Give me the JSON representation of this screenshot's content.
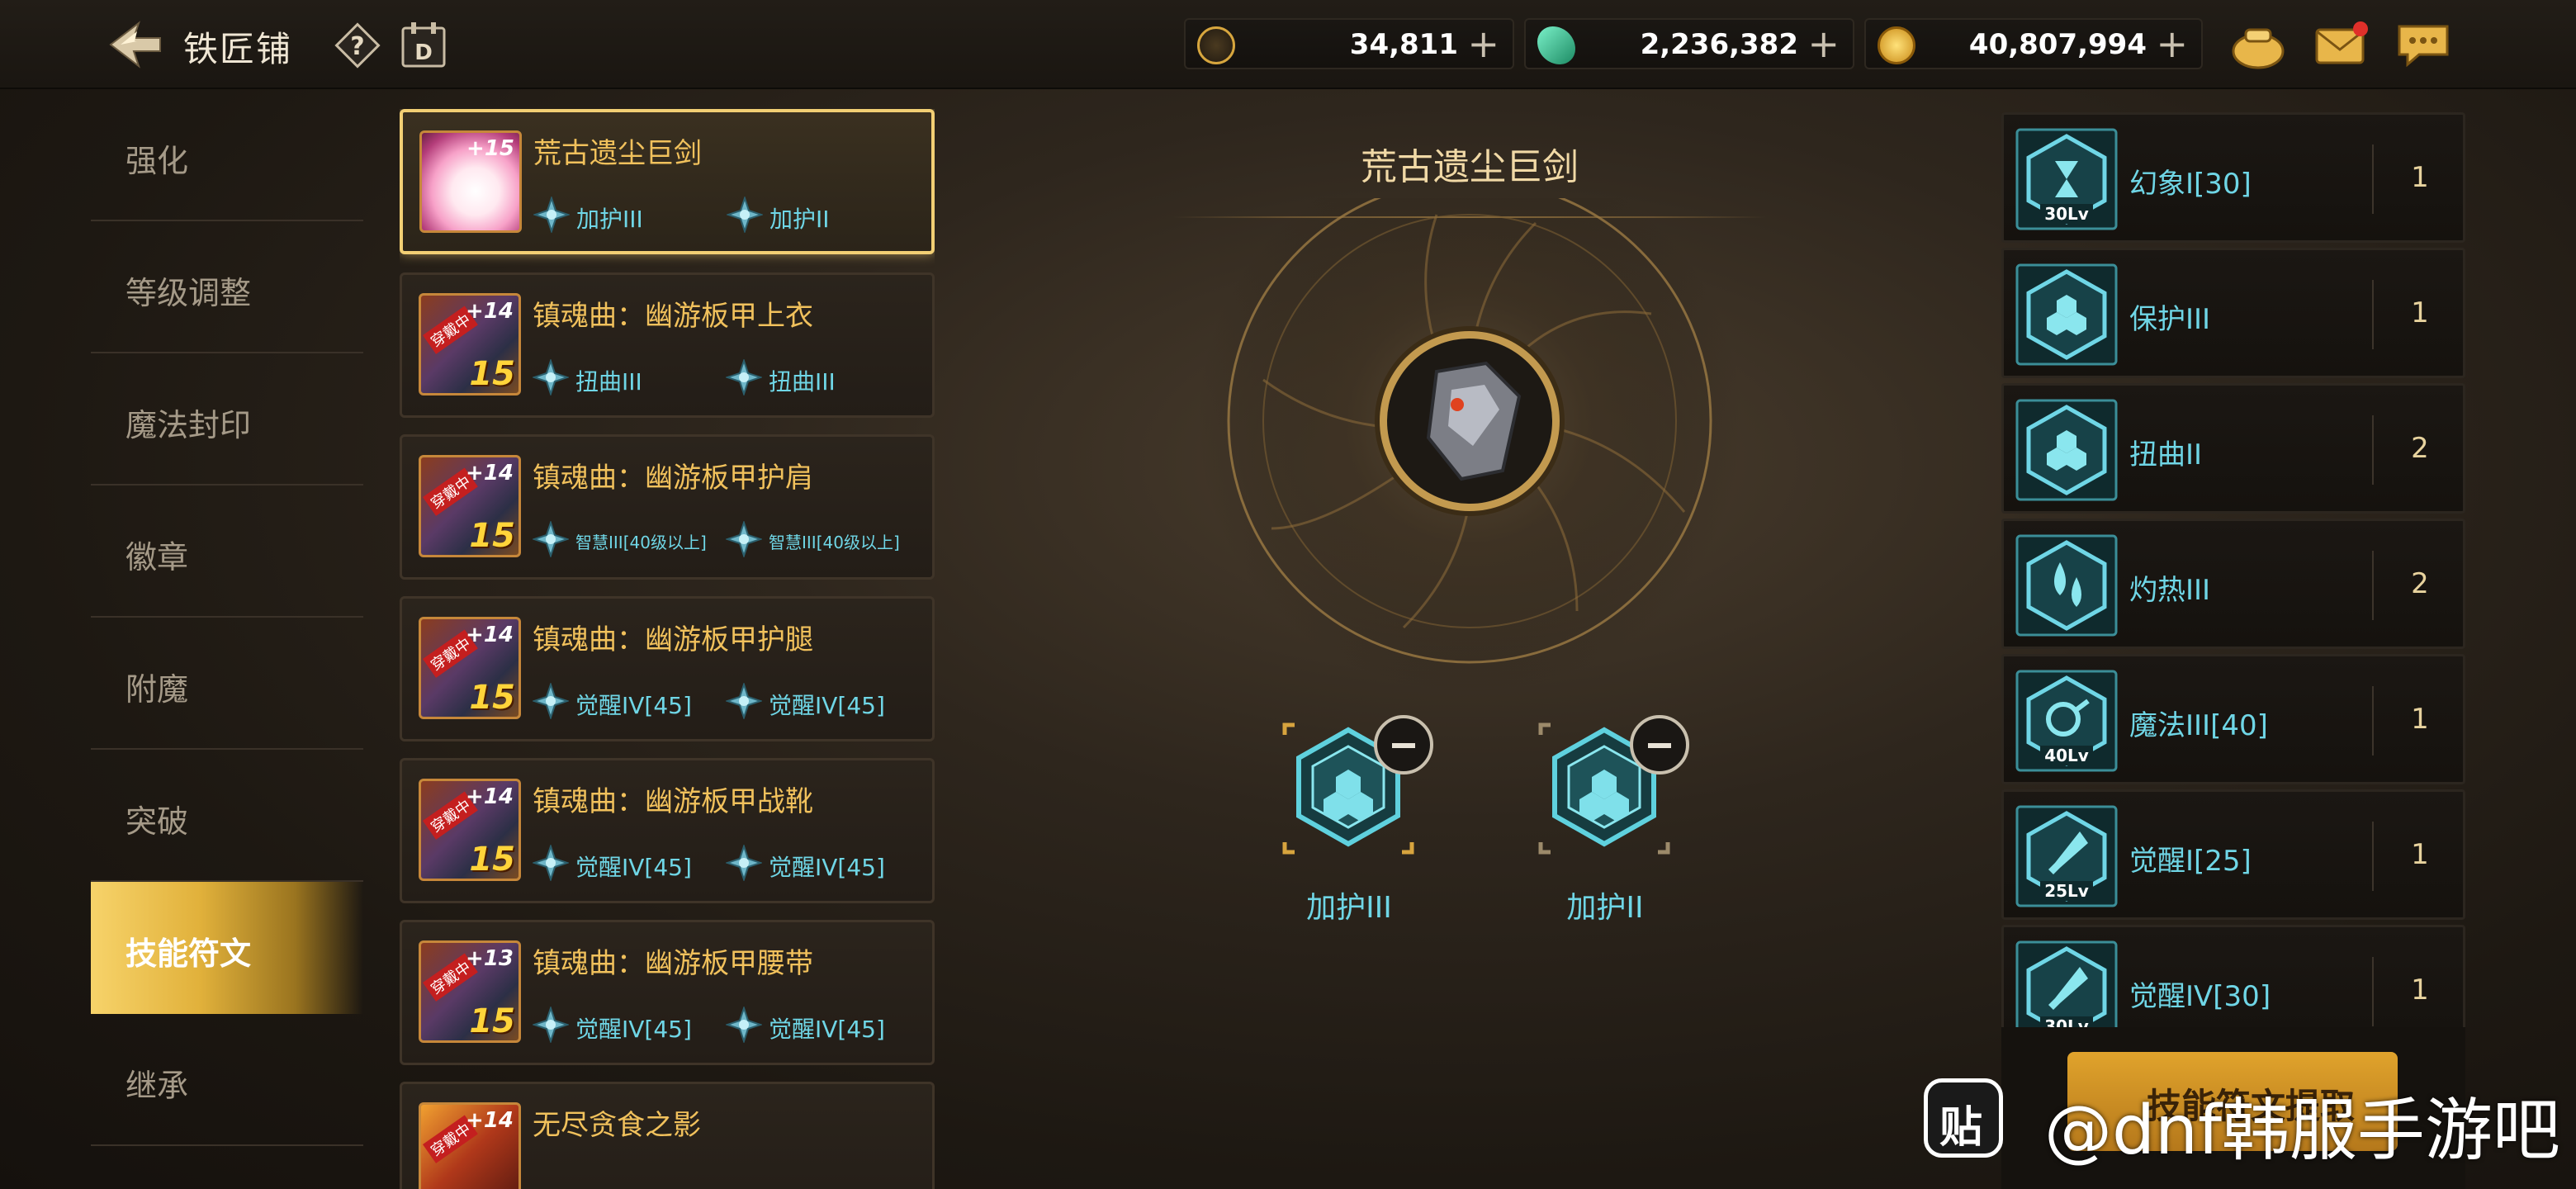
{
  "header": {
    "title": "铁匠铺",
    "currencies": [
      {
        "icon": "crescent-coin-icon",
        "value": "34,811"
      },
      {
        "icon": "green-crystal-icon",
        "value": "2,236,382"
      },
      {
        "icon": "gold-coin-icon",
        "value": "40,807,994"
      }
    ],
    "plus": "+"
  },
  "sidebar": {
    "items": [
      {
        "label": "强化"
      },
      {
        "label": "等级调整"
      },
      {
        "label": "魔法封印"
      },
      {
        "label": "徽章"
      },
      {
        "label": "附魔"
      },
      {
        "label": "突破"
      },
      {
        "label": "技能符文"
      },
      {
        "label": "继承"
      }
    ],
    "active_index": 6
  },
  "items": [
    {
      "name": "荒古遗尘巨剑",
      "badge": "+15",
      "rune1": "加护III",
      "rune2": "加护II"
    },
    {
      "name": "镇魂曲：幽游板甲上衣",
      "level": "15",
      "badge": "+14",
      "tag": "穿戴中",
      "rune1": "扭曲III",
      "rune2": "扭曲III"
    },
    {
      "name": "镇魂曲：幽游板甲护肩",
      "level": "15",
      "badge": "+14",
      "tag": "穿戴中",
      "rune1": "智慧III[40级以上]",
      "rune2": "智慧III[40级以上]"
    },
    {
      "name": "镇魂曲：幽游板甲护腿",
      "level": "15",
      "badge": "+14",
      "tag": "穿戴中",
      "rune1": "觉醒IV[45]",
      "rune2": "觉醒IV[45]"
    },
    {
      "name": "镇魂曲：幽游板甲战靴",
      "level": "15",
      "badge": "+14",
      "tag": "穿戴中",
      "rune1": "觉醒IV[45]",
      "rune2": "觉醒IV[45]"
    },
    {
      "name": "镇魂曲：幽游板甲腰带",
      "level": "15",
      "badge": "+13",
      "tag": "穿戴中",
      "rune1": "觉醒IV[45]",
      "rune2": "觉醒IV[45]"
    },
    {
      "name": "无尽贪食之影",
      "badge": "+14",
      "tag": "穿戴中"
    }
  ],
  "center": {
    "title": "荒古遗尘巨剑",
    "slots": [
      {
        "label": "加护III"
      },
      {
        "label": "加护II"
      }
    ]
  },
  "runes": [
    {
      "name": "幻象I[30]",
      "count": "1",
      "lv": "30Lv"
    },
    {
      "name": "保护III",
      "count": "1",
      "lv": ""
    },
    {
      "name": "扭曲II",
      "count": "2",
      "lv": ""
    },
    {
      "name": "灼热III",
      "count": "2",
      "lv": ""
    },
    {
      "name": "魔法III[40]",
      "count": "1",
      "lv": "40Lv"
    },
    {
      "name": "觉醒I[25]",
      "count": "1",
      "lv": "25Lv"
    },
    {
      "name": "觉醒IV[30]",
      "count": "1",
      "lv": "30Lv"
    }
  ],
  "action": {
    "label": "技能符文提取"
  },
  "watermark": {
    "logo": "贴",
    "text": "@dnf韩服手游吧"
  },
  "colors": {
    "accent_gold": "#f1c15c",
    "rune_cyan": "#6fd6e6",
    "active_nav": "#e1b13b",
    "notify_red": "#e0302a"
  }
}
